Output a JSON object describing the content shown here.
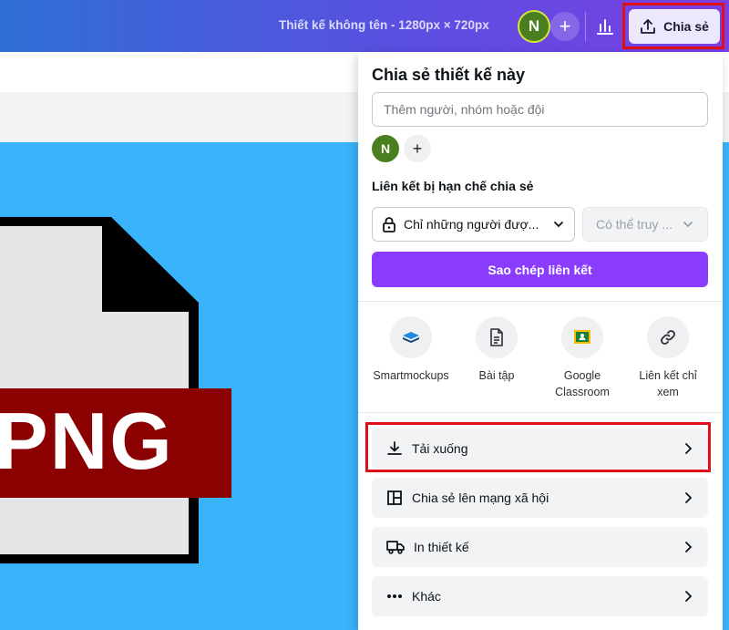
{
  "header": {
    "doc_title": "Thiết kế không tên - 1280px × 720px",
    "avatar_initial": "N",
    "share_label": "Chia sẻ"
  },
  "canvas": {
    "file_label": "PNG",
    "background_color": "#39b4fb",
    "banner_color": "#8b0000"
  },
  "share_panel": {
    "title": "Chia sẻ thiết kế này",
    "people_placeholder": "Thêm người, nhóm hoặc đội",
    "avatar_initial": "N",
    "link_section_label": "Liên kết bị hạn chế chia sẻ",
    "access_value": "Chỉ những người đượ...",
    "permission_value": "Có thể truy ...",
    "copy_link_label": "Sao chép liên kết",
    "apps": [
      {
        "label": "Smartmockups",
        "icon": "smartmockups-icon"
      },
      {
        "label": "Bài tập",
        "icon": "assignment-icon"
      },
      {
        "label": "Google Classroom",
        "icon": "google-classroom-icon"
      },
      {
        "label": "Liên kết chỉ xem",
        "icon": "link-icon"
      }
    ],
    "options": [
      {
        "label": "Tải xuống",
        "icon": "download-icon"
      },
      {
        "label": "Chia sẻ lên mạng xã hội",
        "icon": "social-layout-icon"
      },
      {
        "label": "In thiết kế",
        "icon": "truck-icon"
      },
      {
        "label": "Khác",
        "icon": "more-dots-icon"
      }
    ],
    "accent_color": "#8b3dff"
  }
}
